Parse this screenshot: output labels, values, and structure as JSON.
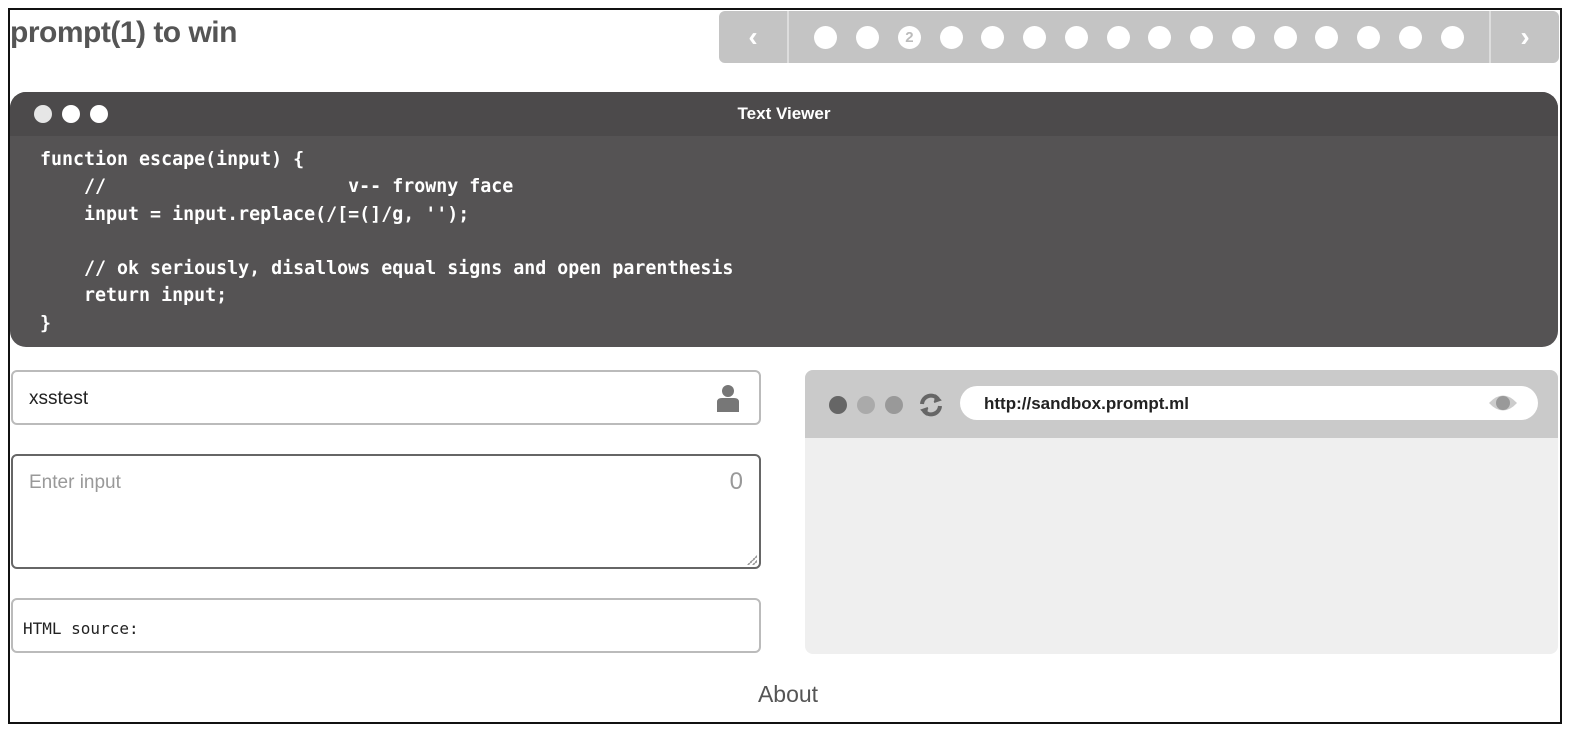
{
  "header": {
    "title": "prompt(1) to win"
  },
  "pager": {
    "prev_icon": "chevron-left-icon",
    "next_icon": "chevron-right-icon",
    "levels": [
      "",
      "",
      "2",
      "",
      "",
      "",
      "",
      "",
      "",
      "",
      "",
      "",
      "",
      "",
      "",
      ""
    ],
    "current_index": 2
  },
  "viewer": {
    "title": "Text Viewer",
    "code": "function escape(input) {\n    //                      v-- frowny face\n    input = input.replace(/[=(]/g, '');\n\n    // ok seriously, disallows equal signs and open parenthesis\n    return input;\n}"
  },
  "form": {
    "username": "xsstest",
    "user_icon": "user-icon",
    "input_placeholder": "Enter input",
    "char_count": "0",
    "html_source_label": "HTML source:"
  },
  "browser": {
    "url": "http://sandbox.prompt.ml",
    "reload_icon": "refresh-icon",
    "eye_icon": "eye-icon"
  },
  "footer": {
    "about": "About"
  }
}
